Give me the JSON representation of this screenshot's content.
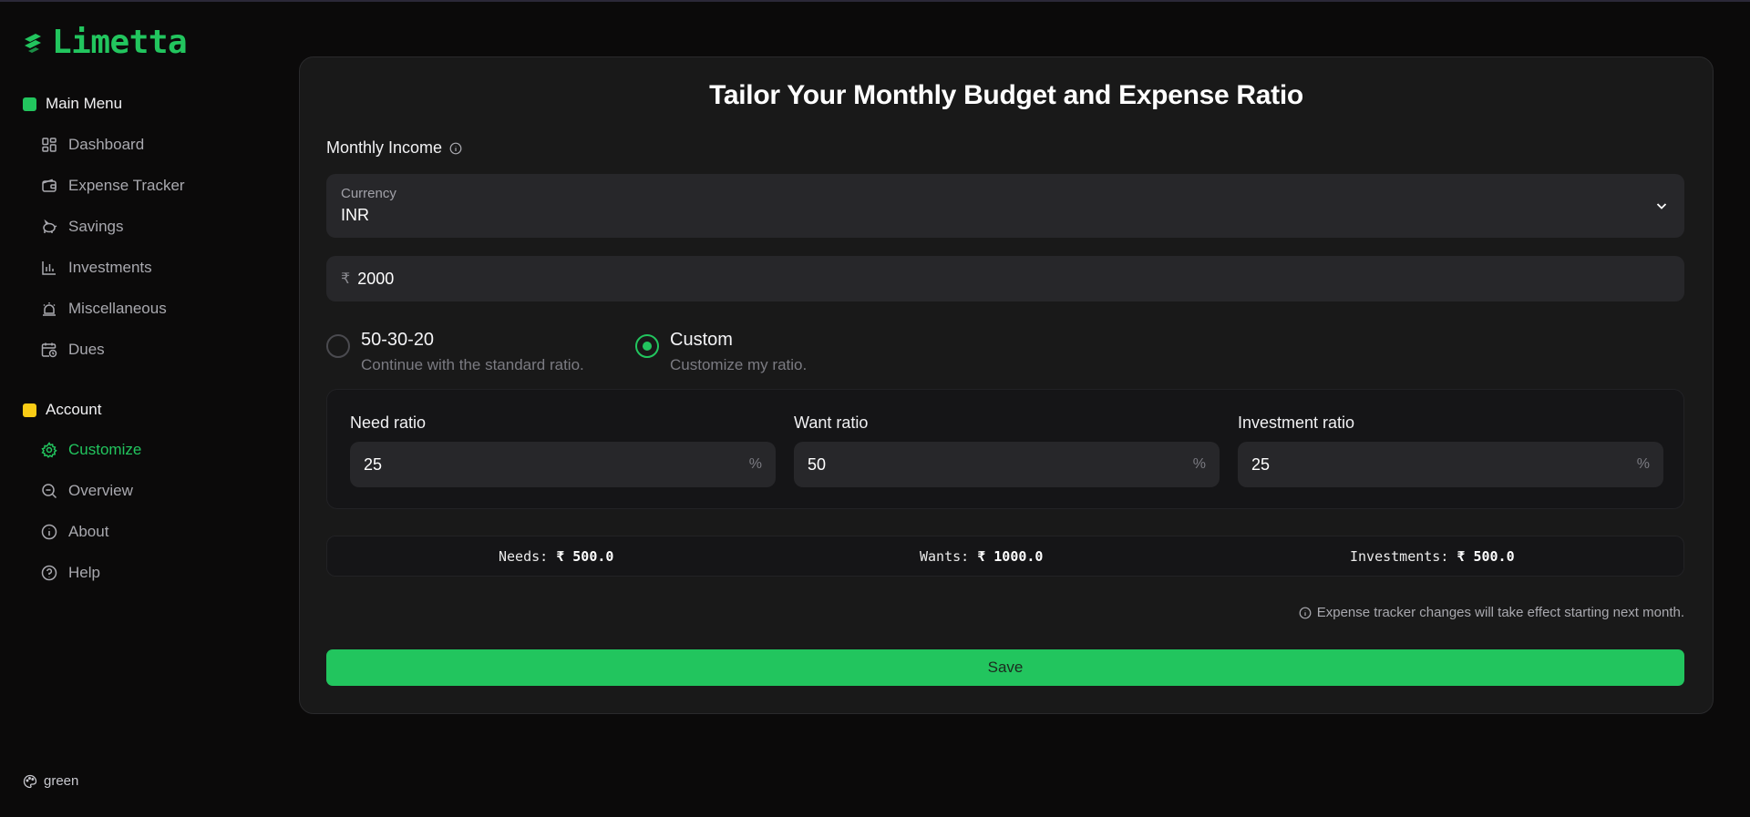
{
  "app": {
    "name": "Limetta"
  },
  "sidebar": {
    "main_menu": {
      "title": "Main Menu",
      "color": "#22c55e",
      "items": [
        {
          "label": "Dashboard",
          "icon": "dashboard-icon"
        },
        {
          "label": "Expense Tracker",
          "icon": "wallet-icon"
        },
        {
          "label": "Savings",
          "icon": "piggy-bank-icon"
        },
        {
          "label": "Investments",
          "icon": "bar-chart-icon"
        },
        {
          "label": "Miscellaneous",
          "icon": "siren-icon"
        },
        {
          "label": "Dues",
          "icon": "calendar-clock-icon"
        }
      ]
    },
    "account": {
      "title": "Account",
      "color": "#facc15",
      "items": [
        {
          "label": "Customize",
          "icon": "gear-icon",
          "active": true
        },
        {
          "label": "Overview",
          "icon": "search-icon"
        },
        {
          "label": "About",
          "icon": "info-icon"
        },
        {
          "label": "Help",
          "icon": "help-icon"
        }
      ]
    },
    "theme": {
      "label": "green",
      "icon": "palette-icon"
    }
  },
  "main": {
    "title": "Tailor Your Monthly Budget and Expense Ratio",
    "income_label": "Monthly Income",
    "currency": {
      "label": "Currency",
      "value": "INR"
    },
    "amount": {
      "symbol": "₹",
      "value": "2000"
    },
    "options": [
      {
        "title": "50-30-20",
        "description": "Continue with the standard ratio.",
        "checked": false
      },
      {
        "title": "Custom",
        "description": "Customize my ratio.",
        "checked": true
      }
    ],
    "ratios": [
      {
        "label": "Need ratio",
        "value": "25",
        "unit": "%"
      },
      {
        "label": "Want ratio",
        "value": "50",
        "unit": "%"
      },
      {
        "label": "Investment ratio",
        "value": "25",
        "unit": "%"
      }
    ],
    "summary": [
      {
        "label": "Needs:",
        "value": "₹ 500.0"
      },
      {
        "label": "Wants:",
        "value": "₹ 1000.0"
      },
      {
        "label": "Investments:",
        "value": "₹ 500.0"
      }
    ],
    "note": "Expense tracker changes will take effect starting next month.",
    "save_label": "Save",
    "accent": "#22c55e"
  }
}
